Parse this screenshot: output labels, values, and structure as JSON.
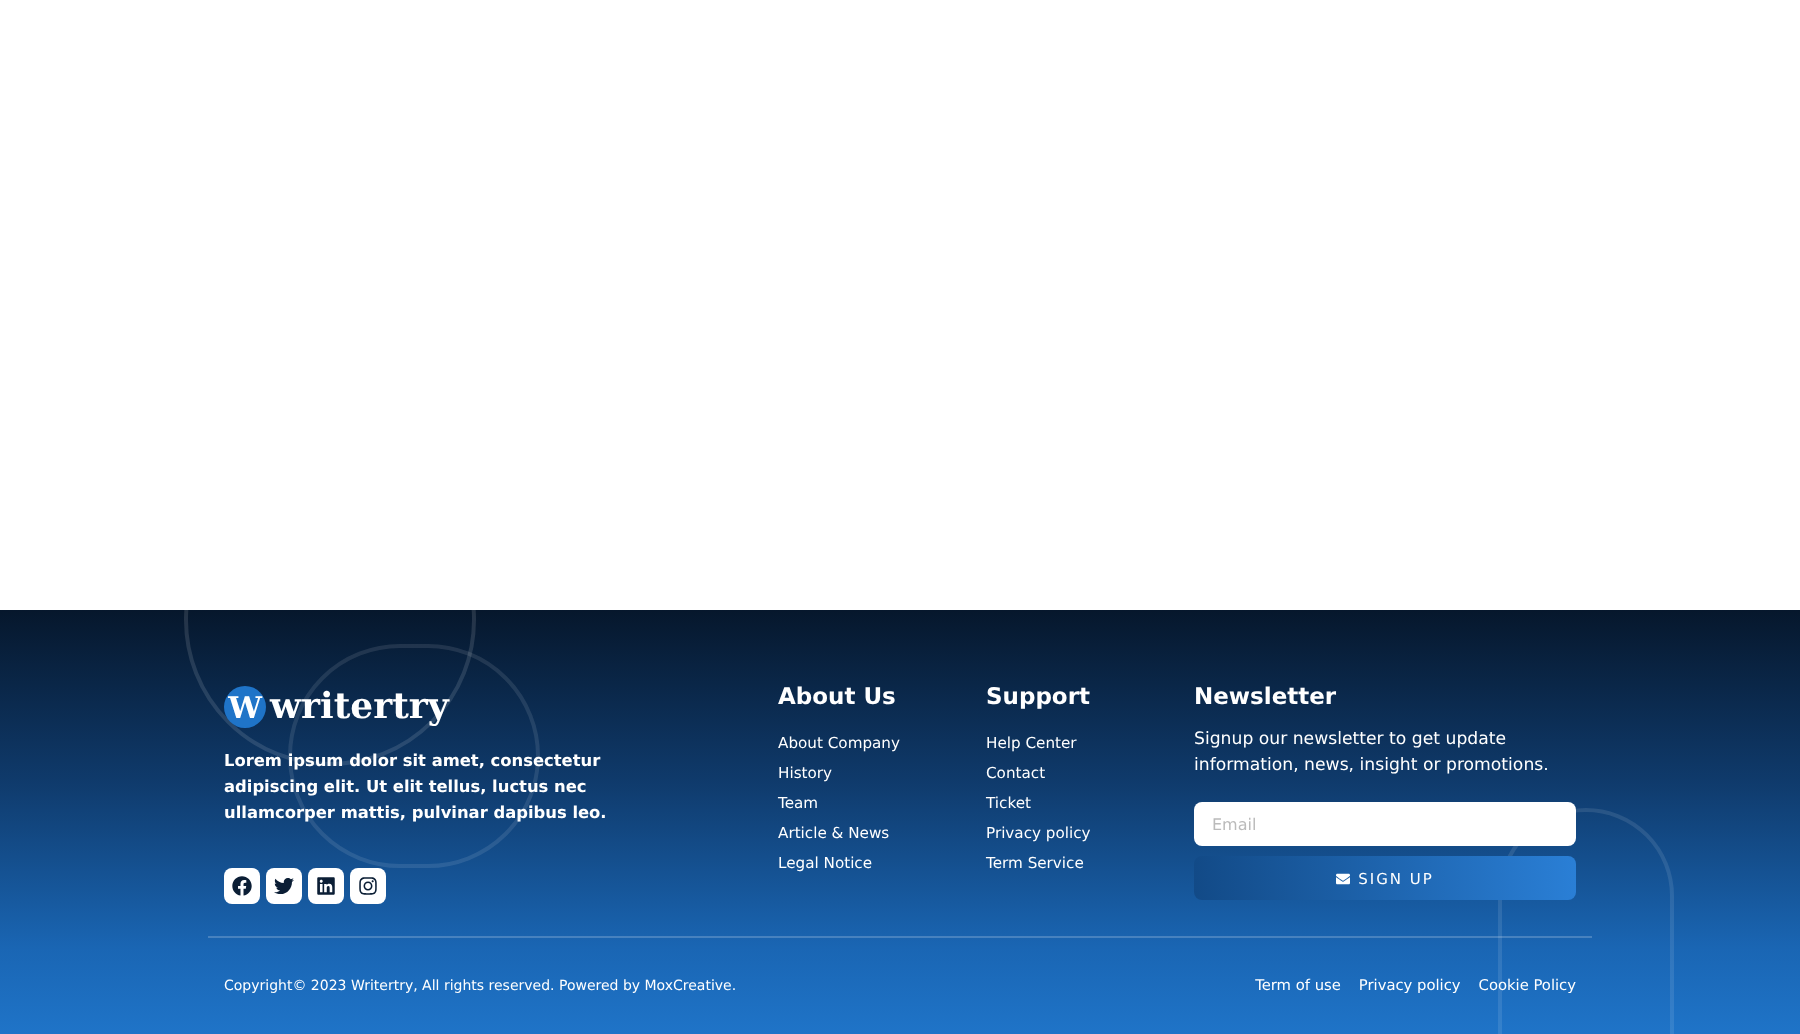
{
  "logo": {
    "mark": "W",
    "name": "writertry"
  },
  "about_text": "Lorem ipsum dolor sit amet, consectetur adipiscing elit. Ut elit tellus, luctus nec ullamcorper mattis, pulvinar dapibus leo.",
  "socials": [
    {
      "kind": "facebook"
    },
    {
      "kind": "twitter"
    },
    {
      "kind": "linkedin"
    },
    {
      "kind": "instagram"
    }
  ],
  "link_columns": [
    {
      "heading": "About Us",
      "links": [
        "About Company",
        "History",
        "Team",
        "Article & News",
        "Legal Notice"
      ]
    },
    {
      "heading": "Support",
      "links": [
        "Help Center",
        "Contact",
        "Ticket",
        "Privacy policy",
        "Term Service"
      ]
    }
  ],
  "newsletter": {
    "heading": "Newsletter",
    "text": "Signup our newsletter to get update information, news, insight or promotions.",
    "email_placeholder": "Email",
    "button": "SIGN UP"
  },
  "copyright": "Copyright© 2023 Writertry, All rights reserved. Powered by MoxCreative.",
  "legal_links": [
    "Term of use",
    "Privacy policy",
    "Cookie Policy"
  ]
}
